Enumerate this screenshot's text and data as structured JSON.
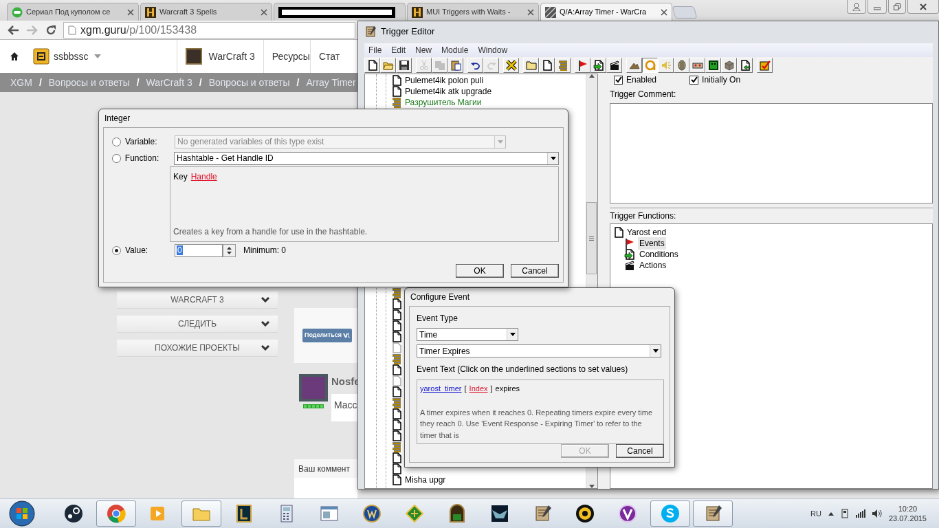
{
  "browser": {
    "tabs": [
      {
        "kind": "badge",
        "title": "Сериал Под куполом се",
        "selected": false
      },
      {
        "kind": "tile",
        "title": "Warcraft 3 Spells",
        "selected": false
      },
      {
        "kind": "redacted",
        "selected": false
      },
      {
        "kind": "tile",
        "title": "MUI Triggers with Waits -",
        "selected": false
      },
      {
        "kind": "hatched",
        "title": "Q/A:Array Timer - WarCra",
        "selected": true
      }
    ],
    "address": {
      "host": "xgm.guru",
      "path": "/p/100/153438"
    }
  },
  "site": {
    "user": "ssbbssc",
    "game": "WarCraft 3",
    "nav_links": [
      "Ресурсы",
      "Стат"
    ],
    "breadcrumbs": [
      {
        "kind": "link",
        "text": "XGM"
      },
      {
        "kind": "sep",
        "text": "/"
      },
      {
        "kind": "link",
        "text": "Вопросы и ответы"
      },
      {
        "kind": "sep",
        "text": "/"
      },
      {
        "kind": "link",
        "text": "WarCraft 3"
      },
      {
        "kind": "sep",
        "text": "/"
      },
      {
        "kind": "link",
        "text": "Вопросы и ответы"
      },
      {
        "kind": "sep",
        "text": "/"
      },
      {
        "kind": "link",
        "text": "Array Timer"
      }
    ],
    "sidebar": [
      "WARCRAFT 3",
      "СЛЕДИТЬ",
      "ПОХОЖИЕ ПРОЕКТЫ"
    ],
    "share": "Поделиться",
    "comment": {
      "author": "Nosfe",
      "text": "Масс"
    },
    "comment_form": "Ваш коммент"
  },
  "trigger_editor": {
    "title": "Trigger Editor",
    "menu": [
      "File",
      "Edit",
      "New",
      "Module",
      "Window"
    ],
    "toolbar": [
      [
        {
          "kind": "new",
          "disabled": false,
          "pressed": false
        },
        {
          "kind": "open",
          "disabled": false,
          "pressed": false
        },
        {
          "kind": "save",
          "disabled": false,
          "pressed": false
        }
      ],
      [
        {
          "kind": "cut",
          "disabled": true,
          "pressed": false
        },
        {
          "kind": "copy",
          "disabled": true,
          "pressed": false
        },
        {
          "kind": "paste",
          "disabled": false,
          "pressed": false
        }
      ],
      [
        {
          "kind": "undo",
          "disabled": false,
          "pressed": false
        },
        {
          "kind": "redo",
          "disabled": true,
          "pressed": false
        }
      ],
      [
        {
          "kind": "delete",
          "disabled": false,
          "pressed": false
        }
      ],
      [
        {
          "kind": "category",
          "disabled": false,
          "pressed": false
        },
        {
          "kind": "trigger",
          "disabled": false,
          "pressed": false
        },
        {
          "kind": "comment",
          "disabled": false,
          "pressed": false
        }
      ],
      [
        {
          "kind": "event",
          "disabled": false,
          "pressed": false
        },
        {
          "kind": "condition",
          "disabled": false,
          "pressed": false
        },
        {
          "kind": "action",
          "disabled": false,
          "pressed": false
        }
      ],
      [
        {
          "kind": "terrain",
          "disabled": false,
          "pressed": false
        },
        {
          "kind": "object",
          "disabled": false,
          "pressed": true
        },
        {
          "kind": "sound",
          "disabled": false,
          "pressed": false
        },
        {
          "kind": "ai",
          "disabled": false,
          "pressed": false
        },
        {
          "kind": "unit",
          "disabled": false,
          "pressed": false
        },
        {
          "kind": "monster",
          "disabled": false,
          "pressed": false
        },
        {
          "kind": "cube",
          "disabled": false,
          "pressed": false
        },
        {
          "kind": "import",
          "disabled": false,
          "pressed": false
        }
      ],
      [
        {
          "kind": "test",
          "disabled": false,
          "pressed": false
        }
      ]
    ],
    "tree_top": [
      {
        "kind": "trigger",
        "label": "Pulemet4ik polon puli"
      },
      {
        "kind": "trigger",
        "label": "Pulemet4ik atk upgrade"
      },
      {
        "kind": "comment",
        "label": "Разрушитель Магии"
      }
    ],
    "tree_bottom": [
      {
        "kind": "comment"
      },
      {
        "kind": "trigger"
      },
      {
        "kind": "trigger"
      },
      {
        "kind": "trigger"
      },
      {
        "kind": "trigger"
      },
      {
        "kind": "disabled"
      },
      {
        "kind": "comment"
      },
      {
        "kind": "trigger"
      },
      {
        "kind": "disabled"
      },
      {
        "kind": "trigger"
      },
      {
        "kind": "comment"
      },
      {
        "kind": "trigger"
      },
      {
        "kind": "trigger"
      },
      {
        "kind": "trigger"
      },
      {
        "kind": "comment"
      },
      {
        "kind": "trigger"
      },
      {
        "kind": "trigger"
      },
      {
        "kind": "trigger",
        "label": "Misha upgr"
      }
    ],
    "enabled": {
      "label": "Enabled",
      "checked": true
    },
    "initially_on": {
      "label": "Initially On",
      "checked": true
    },
    "comment_label": "Trigger Comment:",
    "functions_label": "Trigger Functions:",
    "functions_tree": {
      "label": "Yarost end",
      "children": [
        {
          "kind": "events",
          "label": "Events",
          "selected": true
        },
        {
          "kind": "conditions",
          "label": "Conditions",
          "selected": false
        },
        {
          "kind": "actions",
          "label": "Actions",
          "selected": false
        }
      ]
    }
  },
  "integer_dialog": {
    "title": "Integer",
    "options": [
      {
        "kind": "select",
        "label": "Variable:",
        "selected": false,
        "value": "No generated variables of this type exist",
        "disabled": true
      },
      {
        "kind": "select",
        "label": "Function:",
        "selected": false,
        "value": "Hashtable - Get Handle ID",
        "disabled": false
      },
      {
        "kind": "spin",
        "label": "Value:",
        "selected": true,
        "value": "0",
        "disabled": false
      }
    ],
    "function_text": [
      {
        "kind": "plain",
        "text": "Key"
      },
      {
        "kind": "param",
        "text": "Handle"
      }
    ],
    "description": "Creates a key from a handle for use in the hashtable.",
    "minimum": "Minimum: 0",
    "buttons": [
      {
        "label": "OK",
        "disabled": false
      },
      {
        "label": "Cancel",
        "disabled": false
      }
    ]
  },
  "configure_event": {
    "title": "Configure Event",
    "event_type_label": "Event Type",
    "category": "Time",
    "event": "Timer Expires",
    "event_text_label": "Event Text (Click on the underlined sections to set values)",
    "event_text": [
      {
        "kind": "variable",
        "text": "yarost_timer"
      },
      {
        "kind": "plain",
        "text": "["
      },
      {
        "kind": "param",
        "text": "Index"
      },
      {
        "kind": "plain",
        "text": "]"
      },
      {
        "kind": "plain",
        "text": "expires"
      }
    ],
    "description": "A timer expires when it reaches 0.  Repeating timers expire every time they reach 0.  Use 'Event Response - Expiring Timer' to refer to the timer that is",
    "buttons": [
      {
        "label": "OK",
        "disabled": true
      },
      {
        "label": "Cancel",
        "disabled": false
      }
    ]
  },
  "taskbar": {
    "apps": [
      {
        "kind": "steam",
        "open": false
      },
      {
        "kind": "chrome",
        "open": true
      },
      {
        "kind": "media",
        "open": false
      },
      {
        "kind": "explorer",
        "open": true
      },
      {
        "kind": "lol",
        "open": false
      },
      {
        "kind": "calculator",
        "open": false
      },
      {
        "kind": "window",
        "open": false
      },
      {
        "kind": "wow",
        "open": false
      },
      {
        "kind": "shield",
        "open": false
      },
      {
        "kind": "ru-game",
        "open": false
      },
      {
        "kind": "wings",
        "open": false
      },
      {
        "kind": "scroll",
        "open": false
      },
      {
        "kind": "disc",
        "open": false
      },
      {
        "kind": "emblem",
        "open": false
      },
      {
        "kind": "skype",
        "open": true
      },
      {
        "kind": "scroll",
        "open": true
      }
    ],
    "language": "RU",
    "time": "10:20",
    "date": "23.07.2015"
  }
}
